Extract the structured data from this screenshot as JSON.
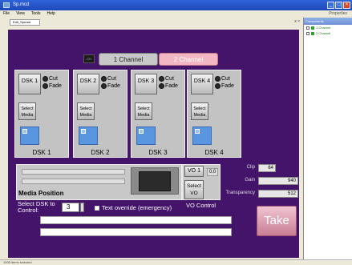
{
  "window": {
    "title": "Sp.mcd"
  },
  "menu": {
    "items": [
      "File",
      "View",
      "Tools",
      "Help"
    ],
    "right_text": "Properties"
  },
  "document": {
    "tab_label": "Edit_Spread",
    "controls": "x ×"
  },
  "right_panel": {
    "header": "Components",
    "items": [
      "1 Channel",
      "2 Channel"
    ]
  },
  "status": {
    "text": "1005 items selected"
  },
  "channels": {
    "icon_text": "CH",
    "channel1": "1 Channel",
    "channel2": "2 Channel"
  },
  "dsks": [
    {
      "button": "DSK 1",
      "cut": "Cut",
      "fade": "Fade",
      "select_media": "Select Media",
      "label": "DSK 1"
    },
    {
      "button": "DSK 2",
      "cut": "Cut",
      "fade": "Fade",
      "select_media": "Select Media",
      "label": "DSK 2"
    },
    {
      "button": "DSK 3",
      "cut": "Cut",
      "fade": "Fade",
      "select_media": "Select Media",
      "label": "DSK 3"
    },
    {
      "button": "DSK 4",
      "cut": "Cut",
      "fade": "Fade",
      "select_media": "Select Media",
      "label": "DSK 4"
    }
  ],
  "media": {
    "label": "Media Position"
  },
  "vo": {
    "vo1": "VO 1",
    "select_vo": "Select VO",
    "value": "0.0",
    "label": "VO Control"
  },
  "fields": {
    "clip_label": "Clip",
    "clip_value": "64",
    "gain_label": "Gain",
    "gain_value": "940",
    "transparency_label": "Transparency",
    "transparency_value": "512"
  },
  "control": {
    "select_label": "Select DSK to Control:",
    "dsk_value": "3",
    "override_label": "Text override (emergency)"
  },
  "take": {
    "label": "Take"
  }
}
